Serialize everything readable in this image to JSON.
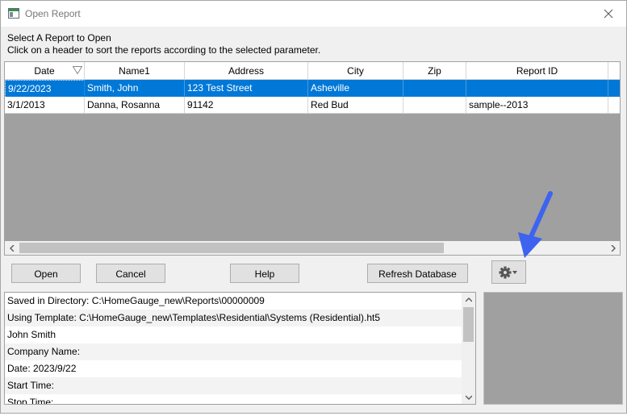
{
  "window": {
    "title": "Open Report"
  },
  "instructions": {
    "line1": "Select A Report to Open",
    "line2": "Click on a header to sort the reports according to the selected parameter."
  },
  "grid": {
    "columns": [
      "Date",
      "Name1",
      "Address",
      "City",
      "Zip",
      "Report ID"
    ],
    "sorted_column": "Date",
    "rows": [
      {
        "date": "9/22/2023",
        "name": "Smith, John",
        "address": "123 Test Street",
        "city": "Asheville",
        "zip": "",
        "report_id": "",
        "selected": true
      },
      {
        "date": "3/1/2013",
        "name": "Danna, Rosanna",
        "address": "91142",
        "city": "Red Bud",
        "zip": "",
        "report_id": "sample--2013",
        "selected": false
      }
    ]
  },
  "buttons": {
    "open": "Open",
    "cancel": "Cancel",
    "help": "Help",
    "refresh": "Refresh Database",
    "settings_icon": "gear-icon"
  },
  "details": {
    "lines": [
      "Saved in Directory: C:\\HomeGauge_new\\Reports\\00000009",
      "Using Template: C:\\HomeGauge_new\\Templates\\Residential\\Systems (Residential).ht5",
      "John Smith",
      "Company Name:",
      "Date: 2023/9/22",
      "Start Time:",
      "Stop Time:"
    ]
  },
  "colors": {
    "selection": "#0078d7",
    "grid_empty": "#a0a0a0",
    "annotation_arrow": "#3d63f0"
  }
}
